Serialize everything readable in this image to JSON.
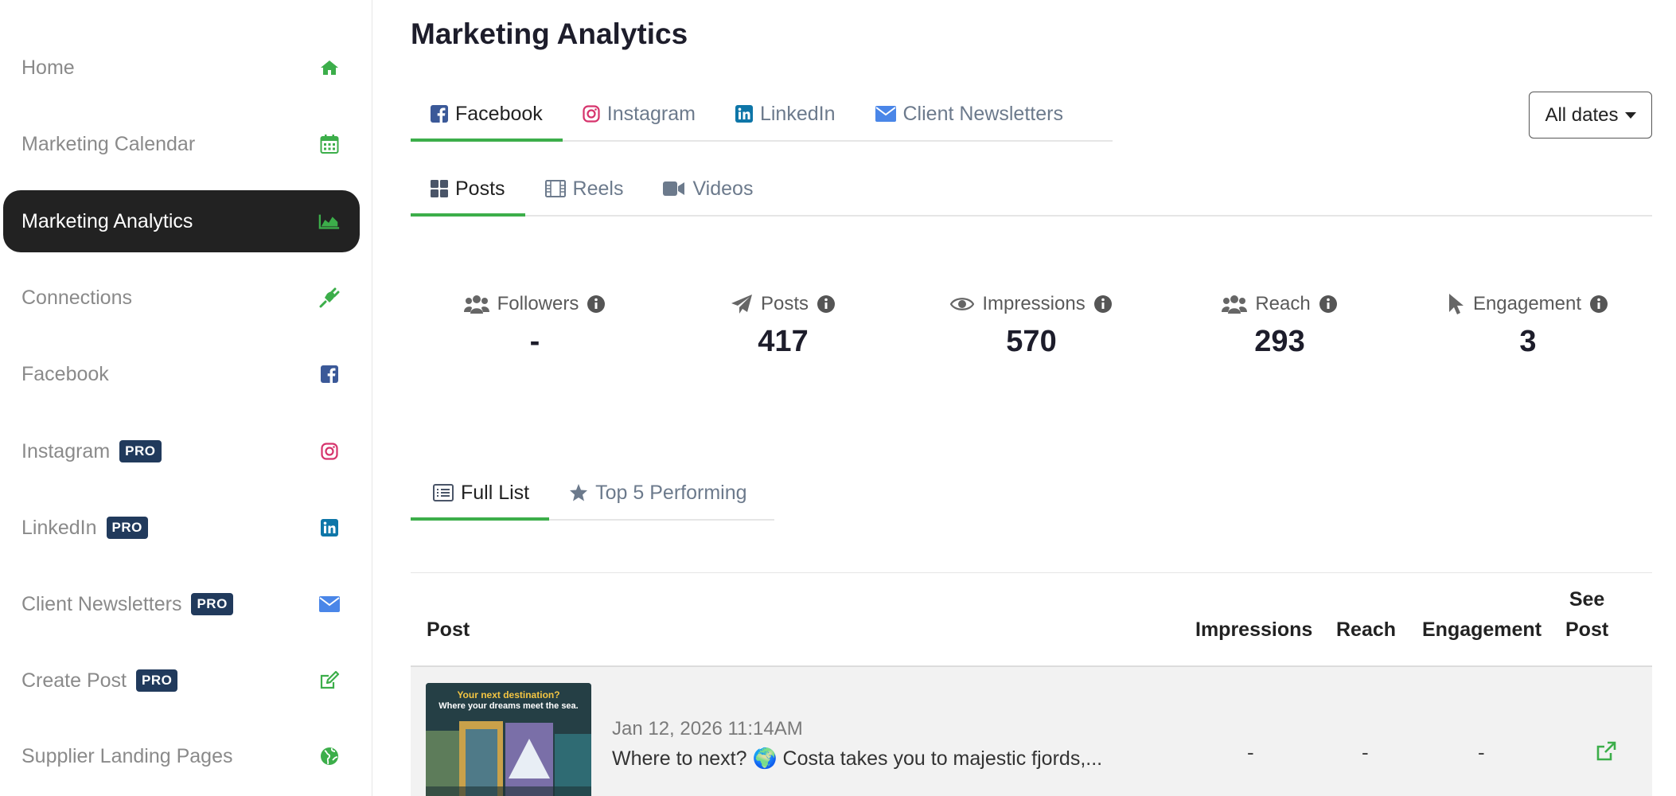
{
  "sidebar": {
    "items": [
      {
        "label": "Home",
        "icon": "home-icon",
        "pro": "",
        "active": false
      },
      {
        "label": "Marketing Calendar",
        "icon": "calendar-icon",
        "pro": "",
        "active": false
      },
      {
        "label": "Marketing Analytics",
        "icon": "area-chart-icon",
        "pro": "",
        "active": true
      },
      {
        "label": "Connections",
        "icon": "plug-icon",
        "pro": "",
        "active": false
      },
      {
        "label": "Facebook",
        "icon": "facebook-icon",
        "pro": "",
        "active": false
      },
      {
        "label": "Instagram",
        "icon": "instagram-icon",
        "pro": "PRO",
        "active": false
      },
      {
        "label": "LinkedIn",
        "icon": "linkedin-icon",
        "pro": "PRO",
        "active": false
      },
      {
        "label": "Client Newsletters",
        "icon": "envelope-icon",
        "pro": "PRO",
        "active": false
      },
      {
        "label": "Create Post",
        "icon": "edit-icon",
        "pro": "PRO",
        "active": false
      },
      {
        "label": "Supplier Landing Pages",
        "icon": "globe-icon",
        "pro": "",
        "active": false
      }
    ]
  },
  "page": {
    "title": "Marketing Analytics"
  },
  "platform_tabs": [
    {
      "label": "Facebook",
      "icon": "facebook-icon",
      "active": true
    },
    {
      "label": "Instagram",
      "icon": "instagram-icon",
      "active": false
    },
    {
      "label": "LinkedIn",
      "icon": "linkedin-icon",
      "active": false
    },
    {
      "label": "Client Newsletters",
      "icon": "envelope-icon",
      "active": false
    }
  ],
  "date_filter": {
    "label": "All dates"
  },
  "content_tabs": [
    {
      "label": "Posts",
      "icon": "grid-icon",
      "active": true
    },
    {
      "label": "Reels",
      "icon": "film-icon",
      "active": false
    },
    {
      "label": "Videos",
      "icon": "video-camera-icon",
      "active": false
    }
  ],
  "stats": [
    {
      "label": "Followers",
      "value": "-",
      "icon": "users-icon"
    },
    {
      "label": "Posts",
      "value": "417",
      "icon": "paper-plane-icon"
    },
    {
      "label": "Impressions",
      "value": "570",
      "icon": "eye-icon"
    },
    {
      "label": "Reach",
      "value": "293",
      "icon": "users-icon"
    },
    {
      "label": "Engagement",
      "value": "3",
      "icon": "pointer-icon"
    }
  ],
  "list_tabs": [
    {
      "label": "Full List",
      "icon": "list-icon",
      "active": true
    },
    {
      "label": "Top 5 Performing",
      "icon": "star-icon",
      "active": false
    }
  ],
  "table": {
    "headers": {
      "post": "Post",
      "impressions": "Impressions",
      "reach": "Reach",
      "engagement": "Engagement",
      "see_post_1": "See",
      "see_post_2": "Post"
    },
    "rows": [
      {
        "thumb_title": "Your next destination?",
        "thumb_subtitle": "Where your dreams meet the sea.",
        "date": "Jan 12, 2026 11:14AM",
        "text": "Where to next? 🌍 Costa takes you to majestic fjords,...",
        "impressions": "-",
        "reach": "-",
        "engagement": "-"
      }
    ]
  },
  "colors": {
    "accent_green": "#3cae4a",
    "sidebar_active": "#222222",
    "pro_badge": "#213a5c",
    "facebook": "#3b5998",
    "linkedin": "#0e76a8",
    "instagram": "#d6336c",
    "email": "#4a86e8"
  }
}
